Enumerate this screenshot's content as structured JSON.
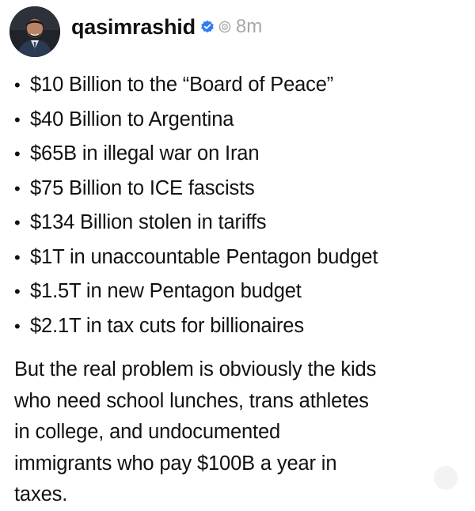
{
  "post": {
    "username": "qasimrashid",
    "timestamp": "8m",
    "verified_icon": "verified-badge-icon",
    "time_icon": "clock-icon",
    "accent_color": "#2f7cf6",
    "bullet_char": "•",
    "bullets": [
      "$10 Billion to the “Board of Peace”",
      "$40 Billion to Argentina",
      "$65B in illegal war on Iran",
      "$75 Billion to ICE fascists",
      "$134 Billion stolen in tariffs",
      "$1T in unaccountable Pentagon budget",
      "$1.5T in new Pentagon budget",
      "$2.1T in tax cuts for billionaires"
    ],
    "paragraph_lines": [
      "But the real problem is obviously the kids",
      "who need school lunches, trans athletes",
      "in college, and undocumented",
      "immigrants who pay $100B a year in",
      "taxes."
    ]
  }
}
